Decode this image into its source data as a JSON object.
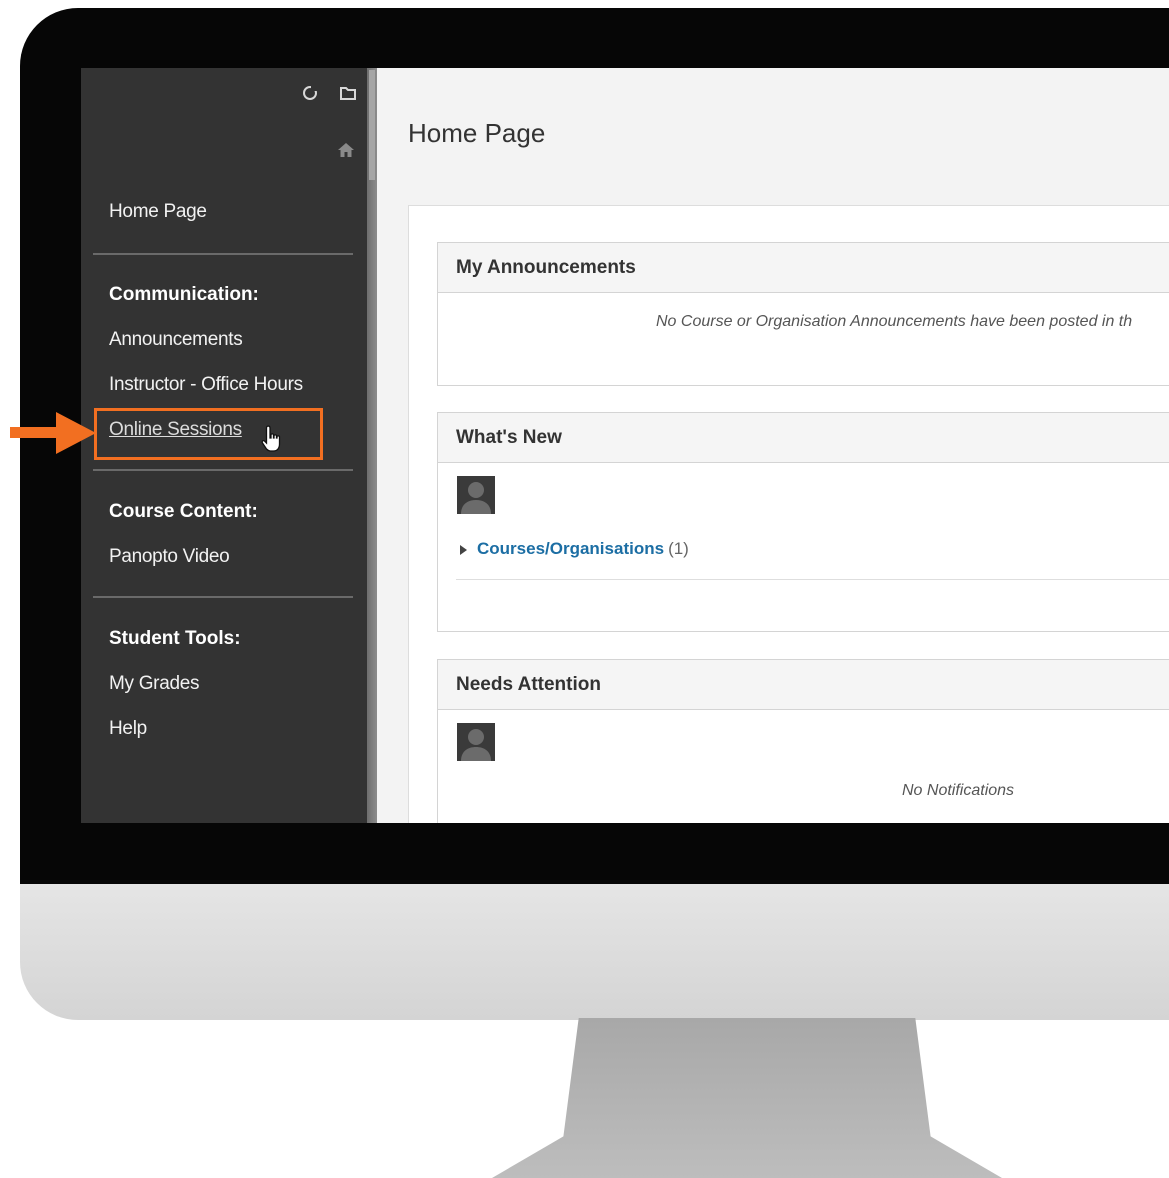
{
  "sidebar": {
    "home_link": "Home Page",
    "sections": [
      {
        "heading": "Communication:",
        "items": [
          "Announcements",
          "Instructor - Office Hours",
          "Online Sessions"
        ]
      },
      {
        "heading": "Course Content:",
        "items": [
          "Panopto Video"
        ]
      },
      {
        "heading": "Student Tools:",
        "items": [
          "My Grades",
          "Help"
        ]
      }
    ],
    "top_icons": [
      "refresh-icon",
      "folder-icon",
      "home-icon"
    ],
    "highlighted_item": "Online Sessions"
  },
  "main": {
    "page_title": "Home Page",
    "modules": {
      "announcements": {
        "title": "My Announcements",
        "empty_text": "No Course or Organisation Announcements have been posted in th"
      },
      "whats_new": {
        "title": "What's New",
        "category_link": "Courses/Organisations",
        "category_count": "(1)"
      },
      "needs_attention": {
        "title": "Needs Attention",
        "empty_text": "No Notifications"
      }
    }
  },
  "colors": {
    "sidebar_bg": "#333333",
    "accent_orange": "#f26f21",
    "link_blue": "#1c6ea4"
  }
}
